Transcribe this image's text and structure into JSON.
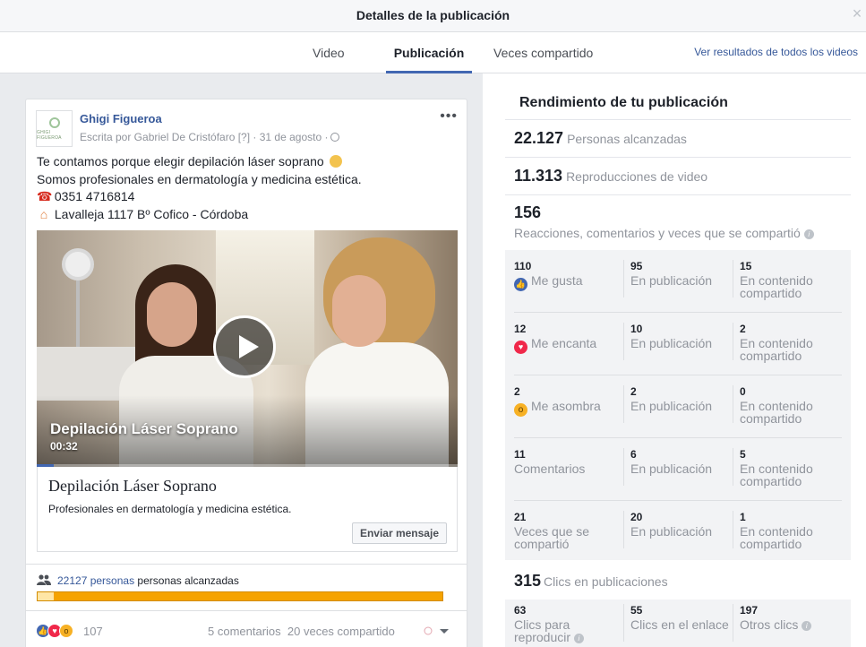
{
  "dialog": {
    "title": "Detalles de la publicación",
    "close_icon": "×"
  },
  "tabs": [
    {
      "label": "Video"
    },
    {
      "label": "Publicación",
      "active": true
    },
    {
      "label": "Veces compartido"
    }
  ],
  "tabs_link": "Ver resultados de todos los videos",
  "post": {
    "avatar_text": "GHIGI FIGUEROA",
    "page_name": "Ghigi Figueroa",
    "meta": "Escrita por Gabriel De Cristófaro [?] · 31 de agosto ·",
    "more_icon": "•••",
    "lines": [
      "Te contamos porque elegir depilación láser soprano",
      "Somos profesionales en dermatología y medicina estética.",
      "0351 4716814",
      "Lavalleja 1117 Bº Cofico - Córdoba"
    ],
    "video": {
      "title": "Depilación Láser Soprano",
      "duration": "00:32",
      "progress": 0.04
    },
    "link_title": "Depilación Láser Soprano",
    "link_desc": "Profesionales en dermatología y medicina estética.",
    "cta_label": "Enviar mensaje",
    "reach": {
      "count_link": "22127 personas",
      "suffix": "personas alcanzadas",
      "organic_fraction": 0.04
    },
    "footer": {
      "reactions": "107",
      "comments": "5 comentarios",
      "shares": "20 veces compartido"
    }
  },
  "performance": {
    "title": "Rendimiento de tu publicación",
    "people_reached": {
      "value": "22.127",
      "label": "Personas alcanzadas"
    },
    "video_views": {
      "value": "11.313",
      "label": "Reproducciones de video"
    },
    "engagement": {
      "value": "156",
      "label": "Reacciones, comentarios y veces que se compartió"
    },
    "rows": [
      {
        "icon": "like-icon",
        "total": "110",
        "label": "Me gusta",
        "on_post": "95",
        "on_post_label": "En publicación",
        "on_shares": "15",
        "on_shares_label": "En contenido compartido"
      },
      {
        "icon": "love-icon",
        "total": "12",
        "label": "Me encanta",
        "on_post": "10",
        "on_post_label": "En publicación",
        "on_shares": "2",
        "on_shares_label": "En contenido compartido"
      },
      {
        "icon": "wow-icon",
        "total": "2",
        "label": "Me asombra",
        "on_post": "2",
        "on_post_label": "En publicación",
        "on_shares": "0",
        "on_shares_label": "En contenido compartido"
      },
      {
        "icon": "",
        "total": "11",
        "label": "Comentarios",
        "on_post": "6",
        "on_post_label": "En publicación",
        "on_shares": "5",
        "on_shares_label": "En contenido compartido"
      },
      {
        "icon": "",
        "total": "21",
        "label": "Veces que se compartió",
        "on_post": "20",
        "on_post_label": "En publicación",
        "on_shares": "1",
        "on_shares_label": "En contenido compartido"
      }
    ],
    "clicks": {
      "value": "315",
      "label": "Clics en publicaciones",
      "play": {
        "value": "63",
        "label": "Clics para reproducir"
      },
      "link": {
        "value": "55",
        "label": "Clics en el enlace"
      },
      "other": {
        "value": "197",
        "label": "Otros clics"
      }
    }
  },
  "colors": {
    "accent": "#4267b2",
    "link": "#365899",
    "reach_bar": "#f5a300",
    "like": "#4267b2",
    "love": "#f0284a",
    "wow": "#f7b125"
  }
}
